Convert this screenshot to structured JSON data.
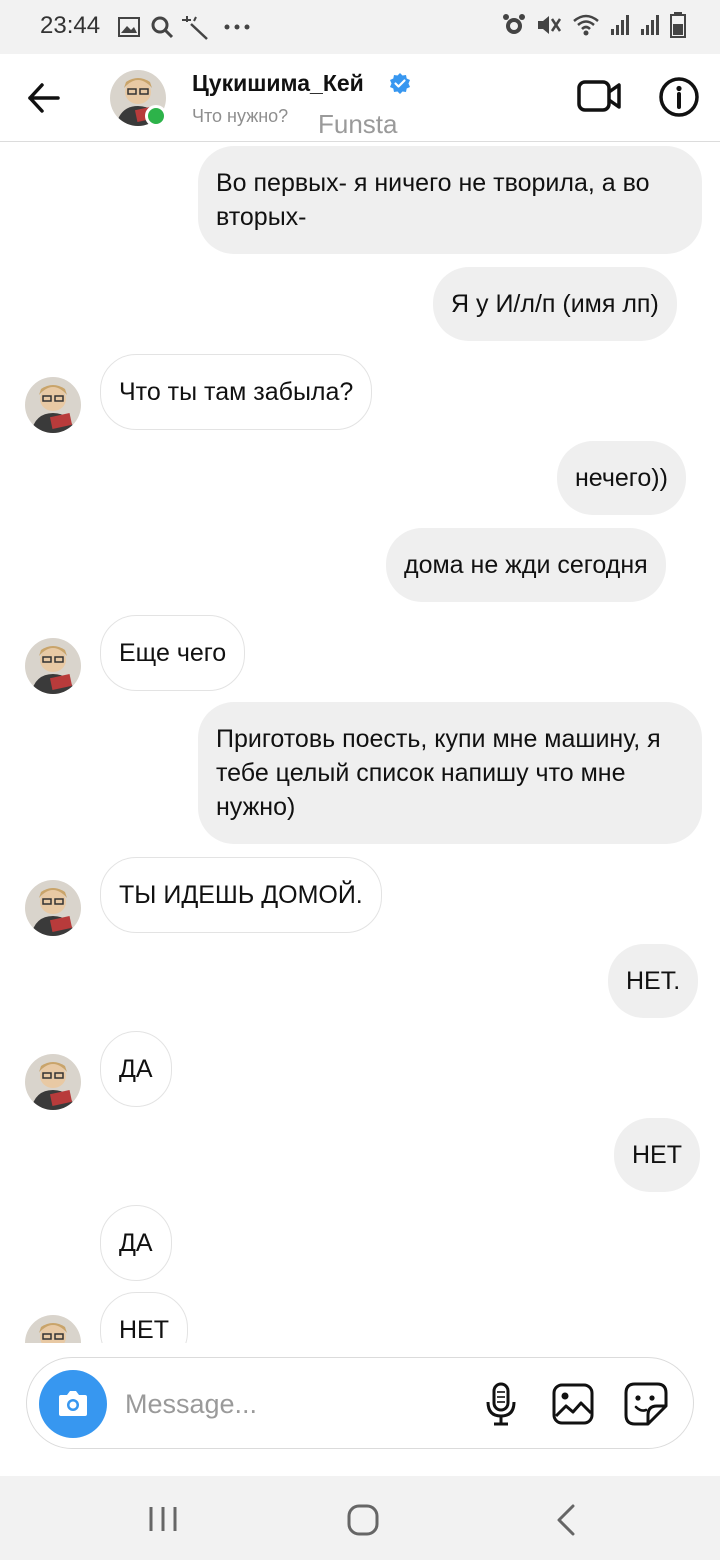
{
  "status_bar": {
    "time": "23:44",
    "left_icons": [
      "image-icon",
      "search-icon",
      "magic-wand-icon",
      "more-dots-icon"
    ],
    "right_icons": [
      "alarm-icon",
      "mute-icon",
      "wifi-icon",
      "signal-icon",
      "signal-icon",
      "battery-icon"
    ]
  },
  "header": {
    "username": "Цукишима_Кей",
    "verified": true,
    "status_text": "Что нужно?",
    "funsta_label": "Funsta",
    "online": true
  },
  "messages": [
    {
      "direction": "out",
      "text": "Во первых- я ничего не творила, а во вторых-"
    },
    {
      "direction": "out",
      "text": "Я у И/л/п (имя лп)"
    },
    {
      "direction": "in",
      "text": "Что ты там забыла?",
      "avatar": true
    },
    {
      "direction": "out",
      "text": "нечего))"
    },
    {
      "direction": "out",
      "text": "дома не жди сегодня"
    },
    {
      "direction": "in",
      "text": "Еще чего",
      "avatar": true
    },
    {
      "direction": "out",
      "text": "Приготовь поесть, купи мне машину, я тебе целый список напишу что мне нужно)"
    },
    {
      "direction": "in",
      "text": "ТЫ ИДЕШЬ ДОМОЙ.",
      "avatar": true
    },
    {
      "direction": "out",
      "text": "НЕТ."
    },
    {
      "direction": "in",
      "text": "ДА",
      "avatar": true
    },
    {
      "direction": "out",
      "text": "НЕТ"
    },
    {
      "direction": "in",
      "text": "ДА",
      "avatar": false
    },
    {
      "direction": "in",
      "text": "НЕТ",
      "avatar": true
    }
  ],
  "composer": {
    "placeholder": "Message..."
  },
  "colors": {
    "accent_blue": "#3797f0",
    "online_green": "#2db34a",
    "outgoing_bubble": "#efefef",
    "verified_blue": "#3897f0"
  }
}
